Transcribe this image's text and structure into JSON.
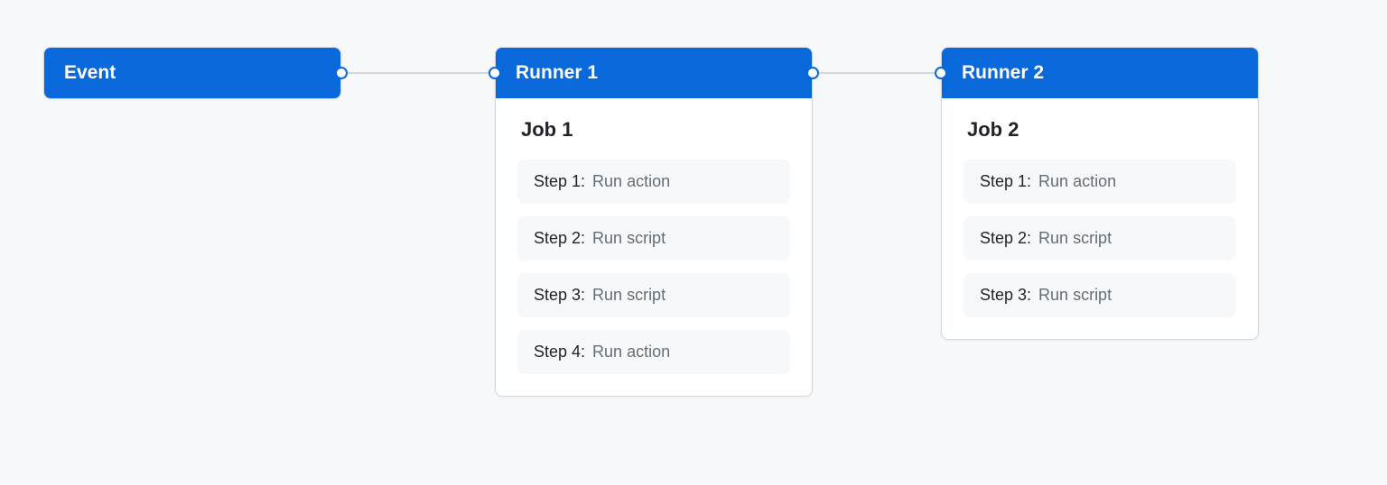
{
  "event": {
    "label": "Event"
  },
  "runners": [
    {
      "label": "Runner 1",
      "job": {
        "title": "Job 1",
        "steps": [
          {
            "label": "Step 1:",
            "desc": "Run action"
          },
          {
            "label": "Step 2:",
            "desc": "Run script"
          },
          {
            "label": "Step 3:",
            "desc": "Run script"
          },
          {
            "label": "Step 4:",
            "desc": "Run action"
          }
        ]
      }
    },
    {
      "label": "Runner 2",
      "job": {
        "title": "Job 2",
        "steps": [
          {
            "label": "Step 1:",
            "desc": "Run action"
          },
          {
            "label": "Step 2:",
            "desc": "Run script"
          },
          {
            "label": "Step 3:",
            "desc": "Run script"
          }
        ]
      }
    }
  ]
}
